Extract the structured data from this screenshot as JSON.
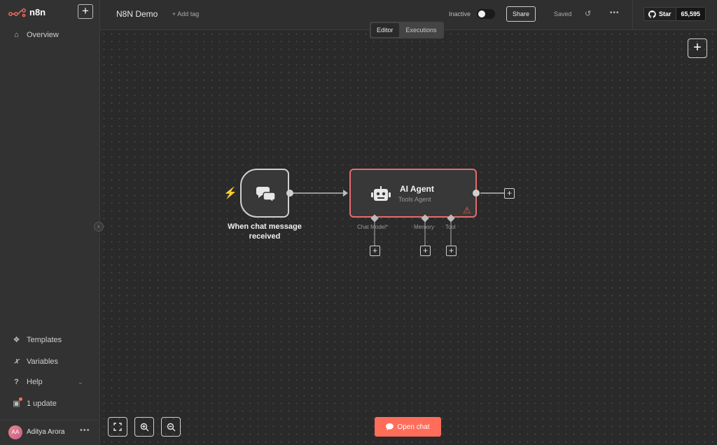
{
  "app": {
    "logo_text": "n8n"
  },
  "sidebar": {
    "items": [
      {
        "label": "Overview",
        "icon": "home-icon"
      },
      {
        "label": "Templates",
        "icon": "templates-icon"
      },
      {
        "label": "Variables",
        "icon": "variables-icon"
      },
      {
        "label": "Help",
        "icon": "help-icon"
      },
      {
        "label": "1 update",
        "icon": "gift-icon"
      }
    ],
    "user": {
      "initials": "AA",
      "name": "Aditya Arora"
    }
  },
  "header": {
    "workflow_name": "N8N Demo",
    "add_tag": "+ Add tag",
    "status_label": "Inactive",
    "share_label": "Share",
    "saved_label": "Saved",
    "github": {
      "label": "Star",
      "count": "65,595"
    }
  },
  "tabs": [
    {
      "label": "Editor",
      "active": true
    },
    {
      "label": "Executions",
      "active": false
    }
  ],
  "nodes": {
    "trigger": {
      "label": "When chat message received"
    },
    "agent": {
      "title": "AI Agent",
      "subtitle": "Tools Agent",
      "ports": [
        "Chat Model*",
        "Memory",
        "Tool"
      ]
    }
  },
  "canvas": {
    "open_chat_label": "Open chat"
  },
  "colors": {
    "accent": "#ff6d5a",
    "error": "#e66b6b"
  }
}
